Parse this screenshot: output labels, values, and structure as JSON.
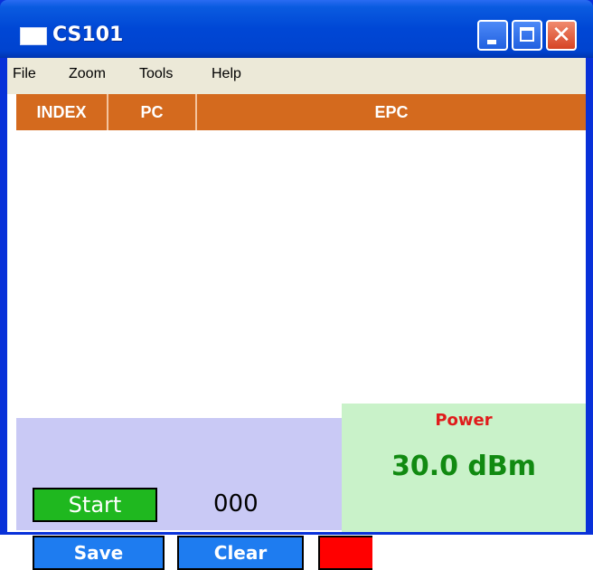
{
  "window": {
    "title": "CS101"
  },
  "menu": {
    "items": [
      "File",
      "Zoom",
      "Tools",
      "Help"
    ]
  },
  "table": {
    "columns": [
      "INDEX",
      "PC",
      "EPC"
    ],
    "rows": []
  },
  "controls": {
    "start_label": "Start",
    "save_label": "Save",
    "clear_label": "Clear",
    "tag_count": "000",
    "second_count_partial": "("
  },
  "power": {
    "label": "Power",
    "value": "30.0 dBm"
  },
  "colors": {
    "titlebar": "#0047d5",
    "header_bg": "#d46a1e",
    "start_bg": "#1fb81f",
    "save_clear_bg": "#1e7cf0",
    "red_button": "#ff0000",
    "power_bg": "#c9f2c9",
    "power_label": "#e01b1b",
    "power_value": "#118a11",
    "bottom_panel": "#c9c9f5"
  }
}
